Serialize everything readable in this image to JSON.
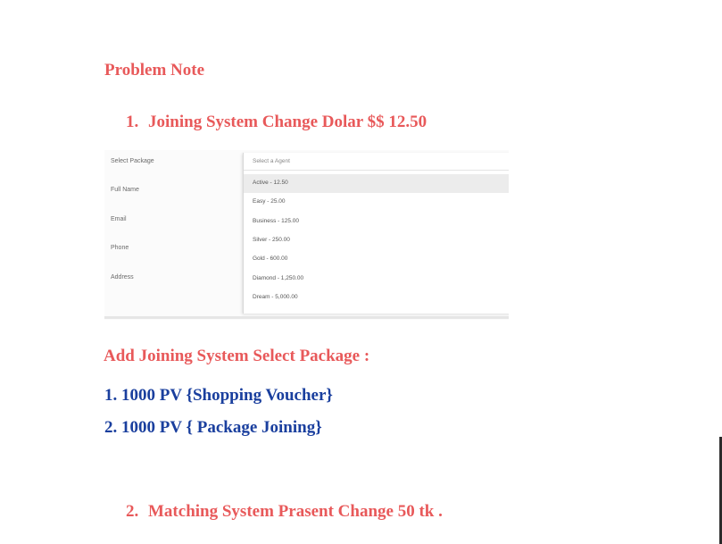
{
  "title": "Problem Note",
  "items": [
    {
      "num": "1.",
      "text": "Joining System Change Dolar $$ 12.50"
    },
    {
      "num": "2.",
      "text": "Matching System Prasent Change 50 tk ."
    }
  ],
  "screenshot": {
    "labels": [
      "Select Package",
      "Full Name",
      "Email",
      "Phone",
      "Address"
    ],
    "select_placeholder": "Select a Agent",
    "options": [
      "Active - 12.50",
      "Easy - 25.00",
      "Business - 125.00",
      "Silver - 250.00",
      "Gold - 600.00",
      "Diamond - 1,250.00",
      "Dream - 5,000.00"
    ],
    "active_option": 0
  },
  "add_heading": "Add Joining System Select Package :",
  "packages": [
    "1. 1000 PV {Shopping Voucher}",
    "2.  1000 PV { Package Joining}"
  ],
  "colors": {
    "accent": "#e8595a",
    "blue": "#1a3f9e"
  }
}
